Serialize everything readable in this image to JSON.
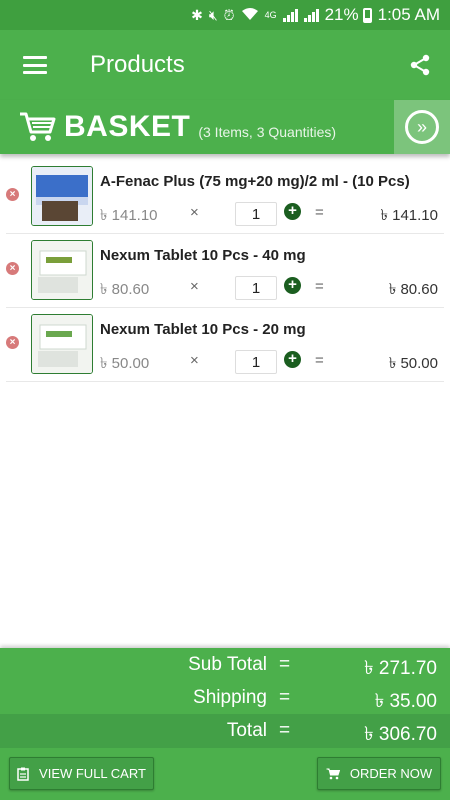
{
  "status_bar": {
    "battery": "21%",
    "time": "1:05 AM",
    "network": "4G",
    "icons": [
      "bluetooth-icon",
      "mute-icon",
      "alarm-icon",
      "wifi-icon",
      "signal-icon",
      "battery-icon"
    ]
  },
  "app_bar": {
    "title": "Products",
    "icons": [
      "menu-icon",
      "share-icon"
    ]
  },
  "basket": {
    "title": "BASKET",
    "subtitle": "(3 Items, 3 Quantities)",
    "toggle_icon": "double-chevron-right-icon"
  },
  "items": [
    {
      "name": "A-Fenac Plus (75 mg+20 mg)/2 ml - (10 Pcs)",
      "price": "৳ 141.10",
      "times": "×",
      "qty": "1",
      "eq": "=",
      "total": "৳ 141.10"
    },
    {
      "name": "Nexum Tablet 10 Pcs - 40 mg",
      "price": "৳ 80.60",
      "times": "×",
      "qty": "1",
      "eq": "=",
      "total": "৳ 80.60"
    },
    {
      "name": "Nexum Tablet 10 Pcs - 20 mg",
      "price": "৳ 50.00",
      "times": "×",
      "qty": "1",
      "eq": "=",
      "total": "৳ 50.00"
    }
  ],
  "summary": {
    "subtotal_label": "Sub Total",
    "subtotal_eq": "=",
    "subtotal_value": "৳ 271.70",
    "shipping_label": "Shipping",
    "shipping_eq": "=",
    "shipping_value": "৳ 35.00",
    "total_label": "Total",
    "total_eq": "=",
    "total_value": "৳ 306.70"
  },
  "actions": {
    "view_cart_label": "VIEW FULL CART",
    "order_now_label": "ORDER NOW"
  },
  "colors": {
    "primary": "#4cb04c",
    "dark_green": "#1b5e20",
    "status_bar": "#3f9f3f",
    "remove": "#d77a7a"
  }
}
